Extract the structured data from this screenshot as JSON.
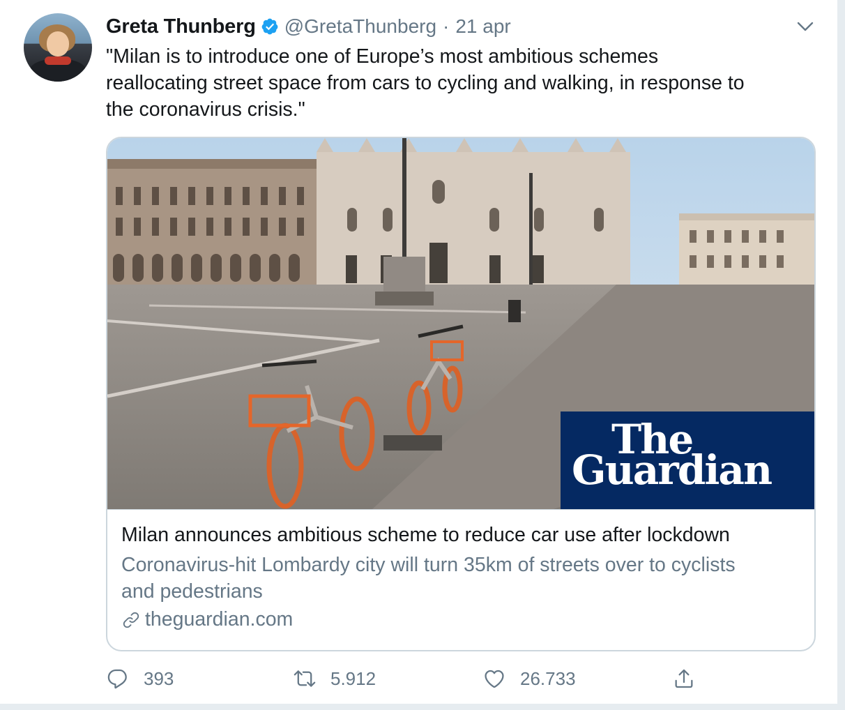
{
  "tweet": {
    "author_name": "Greta Thunberg",
    "handle": "@GretaThunberg",
    "separator": "·",
    "date": "21 apr",
    "text_lines": [
      "\"Milan is to introduce one of Europe’s most ambitious schemes",
      "reallocating street space from cars to cycling and walking, in response to",
      "the coronavirus crisis.\""
    ]
  },
  "card": {
    "image_icon": "milan-duomo-bikes-photo",
    "badge": {
      "line1": "The",
      "line2": "Guardian"
    },
    "title": "Milan announces ambitious scheme to reduce car use after lockdown",
    "description_lines": [
      "Coronavirus-hit Lombardy city will turn 35km of streets over to cyclists",
      "and pedestrians"
    ],
    "domain": "theguardian.com"
  },
  "actions": {
    "replies": "393",
    "retweets": "5.912",
    "likes": "26.733"
  },
  "colors": {
    "text": "#14171a",
    "secondary": "#657786",
    "verified": "#1da1f2",
    "border": "#ccd6dd",
    "guardian_navy": "#052962"
  }
}
